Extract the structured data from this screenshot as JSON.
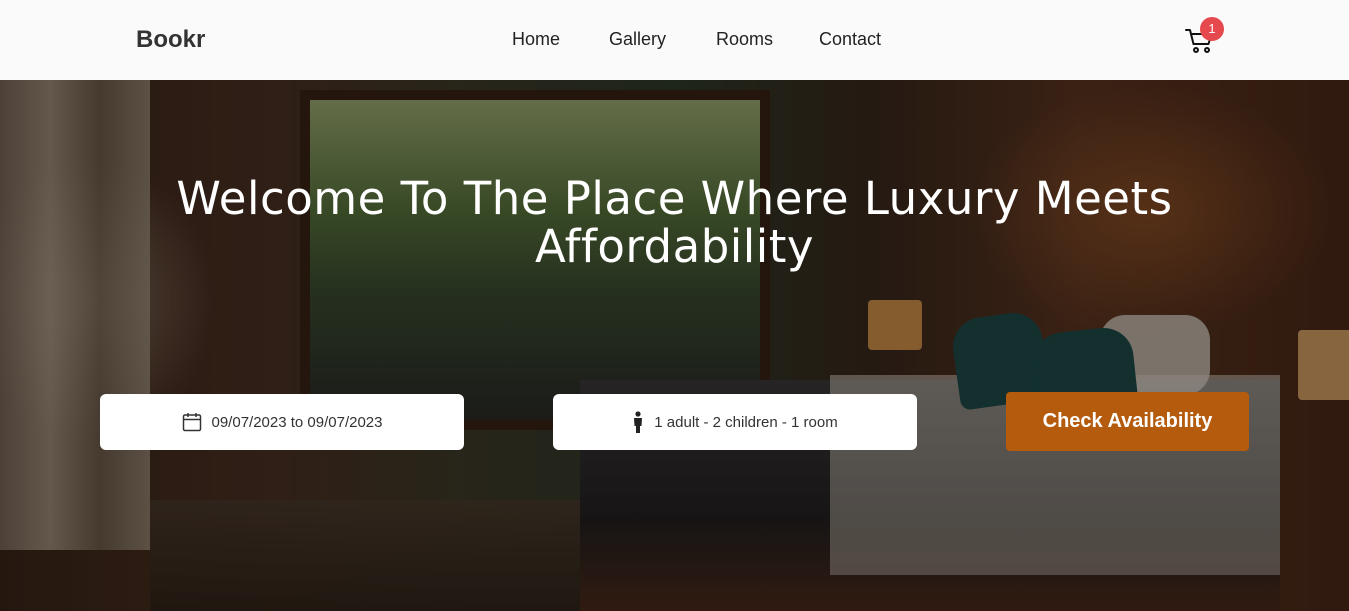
{
  "navbar": {
    "brand": "Bookr",
    "links": [
      "Home",
      "Gallery",
      "Rooms",
      "Contact"
    ],
    "cart_icon": "shopping-cart-icon",
    "cart_count": "1",
    "badge_color": "#e5484d"
  },
  "hero": {
    "title": "Welcome To The Place Where Luxury Meets Affordability"
  },
  "booking": {
    "date_icon": "calendar-icon",
    "date_value": "09/07/2023 to 09/07/2023",
    "guests_icon": "person-icon",
    "guests_value": "1 adult - 2 children - 1 room",
    "button_label": "Check Availability",
    "button_color": "#b45b0e"
  }
}
